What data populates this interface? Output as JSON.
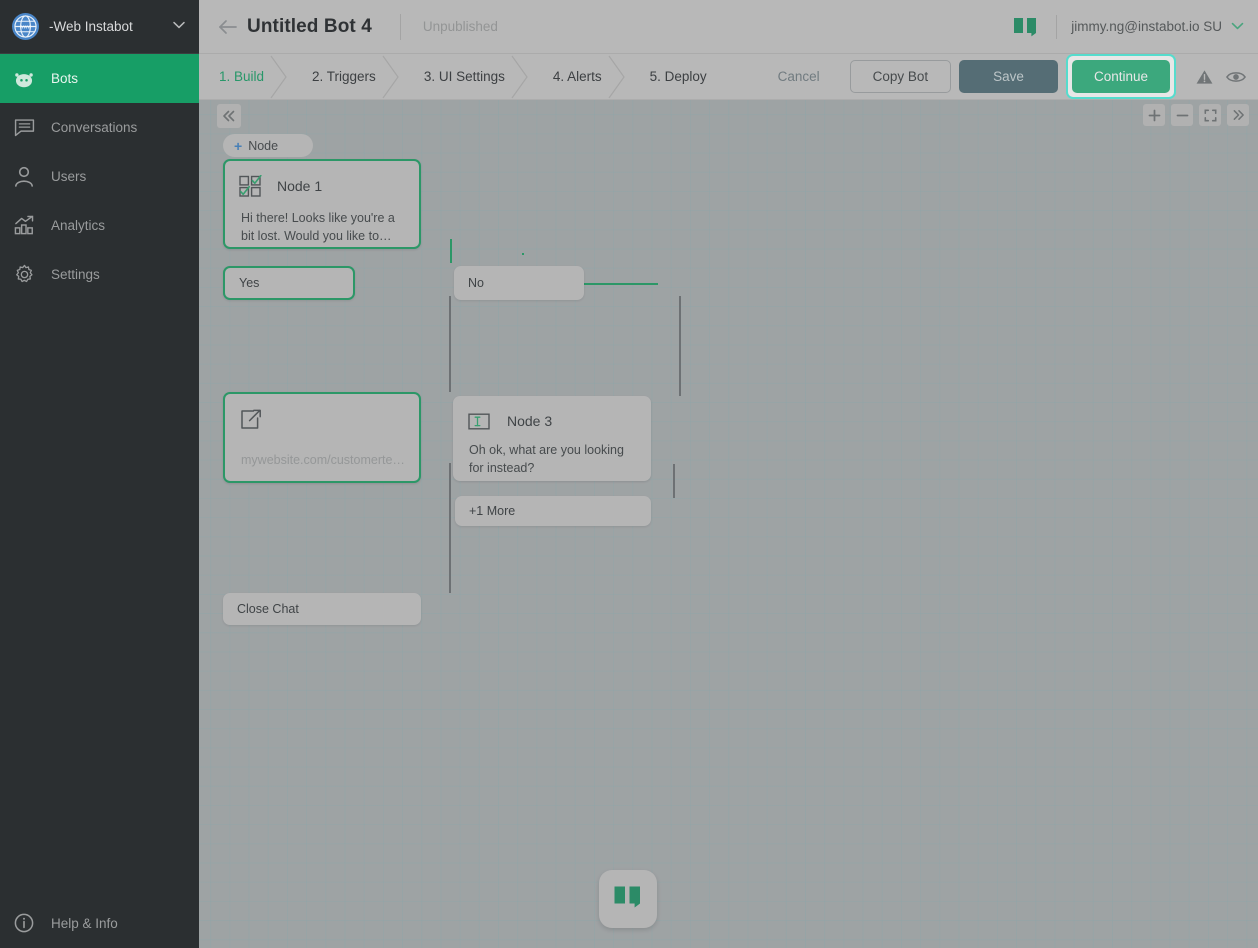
{
  "sidebar": {
    "brand": {
      "name": "-Web Instabot",
      "logo_icon": "globe-www-icon",
      "caret_icon": "chevron-down-icon"
    },
    "items": [
      {
        "label": "Bots",
        "icon": "robot-icon",
        "active": true
      },
      {
        "label": "Conversations",
        "icon": "chat-bubble-icon",
        "active": false
      },
      {
        "label": "Users",
        "icon": "user-icon",
        "active": false
      },
      {
        "label": "Analytics",
        "icon": "bar-chart-arrow-icon",
        "active": false
      },
      {
        "label": "Settings",
        "icon": "gear-icon",
        "active": false
      }
    ],
    "help": {
      "label": "Help & Info",
      "icon": "info-circle-icon"
    }
  },
  "header": {
    "back_icon": "arrow-left-icon",
    "title": "Untitled Bot 4",
    "status": "Unpublished",
    "brand_logo_icon": "instabot-quote-logo",
    "account": "jimmy.ng@instabot.io SU",
    "account_caret_icon": "chevron-down-icon"
  },
  "stepbar": {
    "steps": [
      {
        "label": "1. Build",
        "active": true
      },
      {
        "label": "2. Triggers",
        "active": false
      },
      {
        "label": "3. UI Settings",
        "active": false
      },
      {
        "label": "4. Alerts",
        "active": false
      },
      {
        "label": "5. Deploy",
        "active": false
      }
    ],
    "cancel_label": "Cancel",
    "copy_label": "Copy Bot",
    "save_label": "Save",
    "continue_label": "Continue",
    "warning_icon": "warning-triangle-icon",
    "preview_icon": "eye-icon"
  },
  "canvas": {
    "collapse_icon": "chevrons-left-icon",
    "tools": [
      {
        "icon": "plus-icon",
        "name": "zoom-in"
      },
      {
        "icon": "minus-icon",
        "name": "zoom-out"
      },
      {
        "icon": "fit-screen-icon",
        "name": "fit-to-screen"
      },
      {
        "icon": "chevrons-right-icon",
        "name": "expand-panel"
      }
    ],
    "add_node_label": "Node",
    "add_node_icon": "plus-icon",
    "nodes": [
      {
        "id": "node1",
        "title": "Node 1",
        "icon": "multiple-choice-icon",
        "body": "Hi there! Looks like you're a bit lost. Would you like to…",
        "selected": true
      },
      {
        "id": "node-link",
        "title": "",
        "icon": "external-link-icon",
        "body": "mywebsite.com/customerte…",
        "placeholder": true,
        "selected": true
      },
      {
        "id": "node3",
        "title": "Node 3",
        "icon": "text-input-icon",
        "body": "Oh ok, what are you looking for instead?",
        "selected": false
      }
    ],
    "chips": [
      {
        "id": "yes",
        "label": "Yes",
        "selected": true
      },
      {
        "id": "no",
        "label": "No",
        "selected": false
      },
      {
        "id": "more",
        "label": "+1 More",
        "selected": false,
        "stacked": true
      },
      {
        "id": "close",
        "label": "Close Chat",
        "selected": false
      }
    ],
    "fab_icon": "instabot-quote-logo"
  },
  "colors": {
    "accent_green": "#179e66",
    "node_green": "#1b9e63",
    "continue_green": "#2fb37e",
    "highlight_cyan": "#4ff2e0",
    "save_slate": "#4d6b74",
    "sidebar_dark": "#2b2f31",
    "canvas_gray": "#a7acae"
  }
}
